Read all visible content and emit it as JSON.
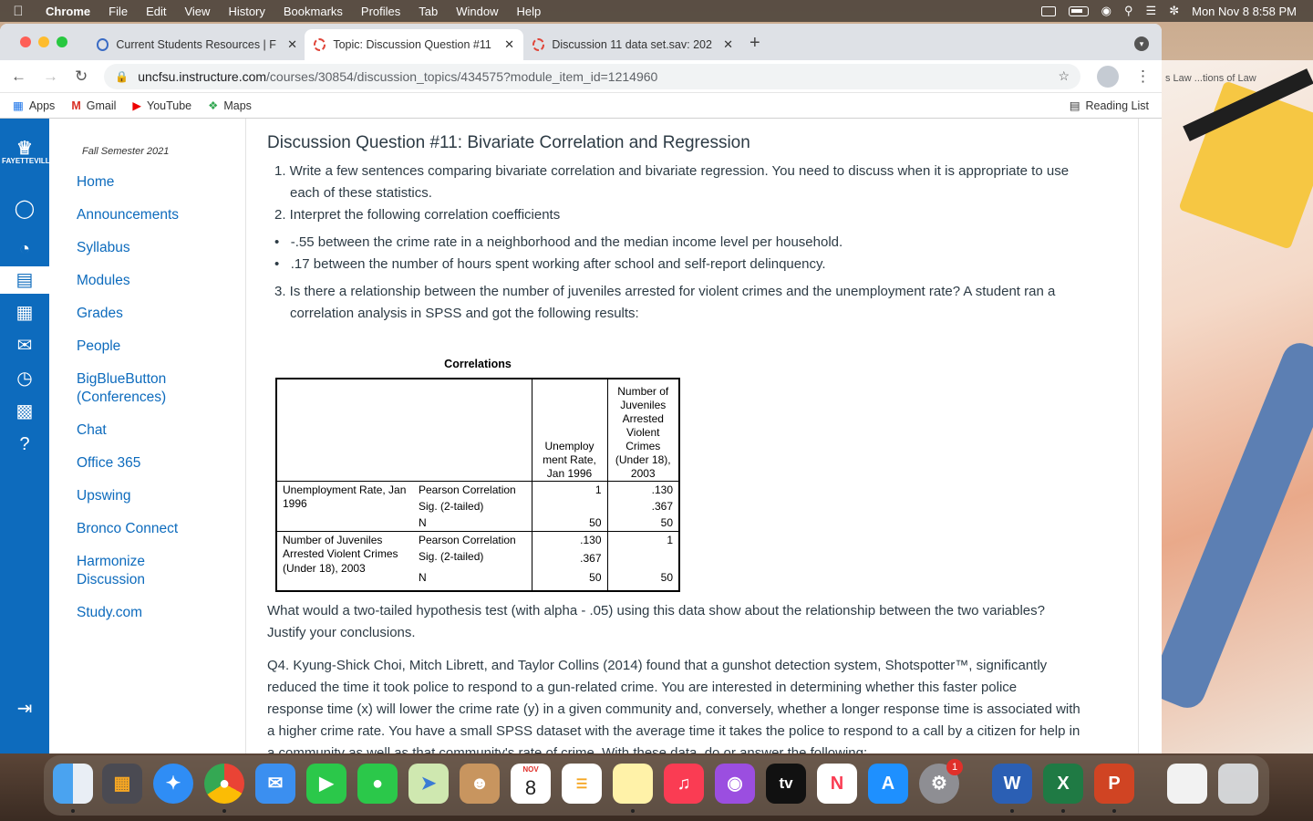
{
  "menubar": {
    "items": [
      "Chrome",
      "File",
      "Edit",
      "View",
      "History",
      "Bookmarks",
      "Profiles",
      "Tab",
      "Window",
      "Help"
    ],
    "clock": "Mon Nov 8  8:58 PM"
  },
  "tabs": [
    {
      "title": "Current Students Resources | F"
    },
    {
      "title": "Topic: Discussion Question #11"
    },
    {
      "title": "Discussion 11 data set.sav: 202"
    }
  ],
  "address": {
    "host": "uncfsu.instructure.com",
    "path": "/courses/30854/discussion_topics/434575?module_item_id=1214960"
  },
  "bookmarks": [
    "Apps",
    "Gmail",
    "YouTube",
    "Maps"
  ],
  "reading_list": "Reading List",
  "bg_tab_ghost": "s Law ...tions of Law",
  "global_nav_logo": "FAYETTEVILLE",
  "course_nav": {
    "term": "Fall Semester 2021",
    "links": [
      "Home",
      "Announcements",
      "Syllabus",
      "Modules",
      "Grades",
      "People",
      "BigBlueButton (Conferences)",
      "Chat",
      "Office 365",
      "Upswing",
      "Bronco Connect",
      "Harmonize Discussion",
      "Study.com"
    ]
  },
  "content": {
    "heading": "Discussion Question #11: Bivariate Correlation and Regression",
    "q1_line1": "1. Write a few sentences comparing bivariate correlation and bivariate regression. You need to discuss when it is appropriate to use",
    "q1_line2": "each of these statistics.",
    "q2": "2. Interpret the following correlation coefficients",
    "bullet1": "-.55 between the crime rate in a neighborhood and the median income level per household.",
    "bullet2": ".17 between the number of hours spent working after school and self-report delinquency.",
    "q3_line1": "3. Is there a relationship between the number of juveniles arrested for violent crimes and the unemployment rate? A student ran a",
    "q3_line2": "correlation analysis in SPSS and got the following results:",
    "after_line1": "What would a two-tailed hypothesis test (with alpha - .05) using this data show about the relationship between the two variables?",
    "after_line2": "Justify your conclusions.",
    "q4_line1": "Q4.  Kyung-Shick Choi, Mitch Librett, and Taylor Collins (2014) found that a gunshot detection system, Shotspotter™, significantly",
    "q4_line2": "reduced the time it took police to respond to a gun-related crime. You are interested in determining whether this faster police",
    "q4_line3": "response time (x) will lower the crime rate (y) in a given community and, conversely, whether a longer response time is associated with",
    "q4_line4": "a higher crime rate. You have a small SPSS dataset with the average time it takes the police to respond to a call by a citizen for help in",
    "q4_line5": "a community as well as that community's rate of crime. With these data, do or answer the following:"
  },
  "spss": {
    "caption": "Correlations",
    "col1": "Unemploy ment Rate, Jan 1996",
    "col2": "Number of Juveniles Arrested Violent Crimes (Under 18), 2003",
    "row1_label": "Unemployment Rate, Jan 1996",
    "row2_label": "Number of Juveniles Arrested Violent Crimes (Under 18), 2003",
    "stat_pc": "Pearson Correlation",
    "stat_sig": "Sig. (2-tailed)",
    "stat_n": "N",
    "r1": {
      "pc1": "1",
      "pc2": ".130",
      "sig2": ".367",
      "n1": "50",
      "n2": "50"
    },
    "r2": {
      "pc1": ".130",
      "pc2": "1",
      "sig1": ".367",
      "n1": "50",
      "n2": "50"
    }
  },
  "dock": {
    "calendar_month": "NOV",
    "calendar_day": "8",
    "settings_badge": "1",
    "tv_label": "tv"
  }
}
